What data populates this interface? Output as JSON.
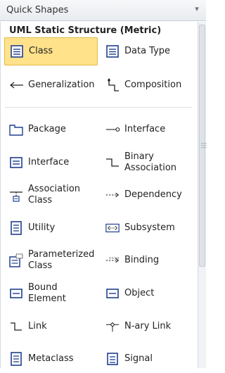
{
  "header": {
    "title": "Quick Shapes"
  },
  "stencil": {
    "title": "UML Static Structure (Metric)"
  },
  "items": [
    {
      "label": "Class",
      "icon": "class-icon",
      "selected": true
    },
    {
      "label": "Data Type",
      "icon": "data-type-icon"
    },
    {
      "label": "Generalization",
      "icon": "generalization-arrow-icon"
    },
    {
      "label": "Composition",
      "icon": "composition-connector-icon"
    },
    {
      "label": "Package",
      "icon": "package-folder-icon"
    },
    {
      "label": "Interface",
      "icon": "interface-lollipop-icon"
    },
    {
      "label": "Interface",
      "icon": "interface-class-icon"
    },
    {
      "label": "Binary\nAssociation",
      "icon": "binary-association-icon"
    },
    {
      "label": "Association\nClass",
      "icon": "association-class-icon"
    },
    {
      "label": "Dependency",
      "icon": "dependency-dashed-arrow-icon"
    },
    {
      "label": "Utility",
      "icon": "utility-icon"
    },
    {
      "label": "Subsystem",
      "icon": "subsystem-icon"
    },
    {
      "label": "Parameterized\nClass",
      "icon": "parameterized-class-icon"
    },
    {
      "label": "Binding",
      "icon": "binding-icon"
    },
    {
      "label": "Bound\nElement",
      "icon": "bound-element-icon"
    },
    {
      "label": "Object",
      "icon": "object-icon"
    },
    {
      "label": "Link",
      "icon": "link-icon"
    },
    {
      "label": "N-ary Link",
      "icon": "n-ary-link-icon"
    },
    {
      "label": "Metaclass",
      "icon": "metaclass-icon"
    },
    {
      "label": "Signal",
      "icon": "signal-icon"
    }
  ],
  "colors": {
    "selected_bg": "#ffe28a",
    "icon_blue": "#1f3f8f"
  }
}
